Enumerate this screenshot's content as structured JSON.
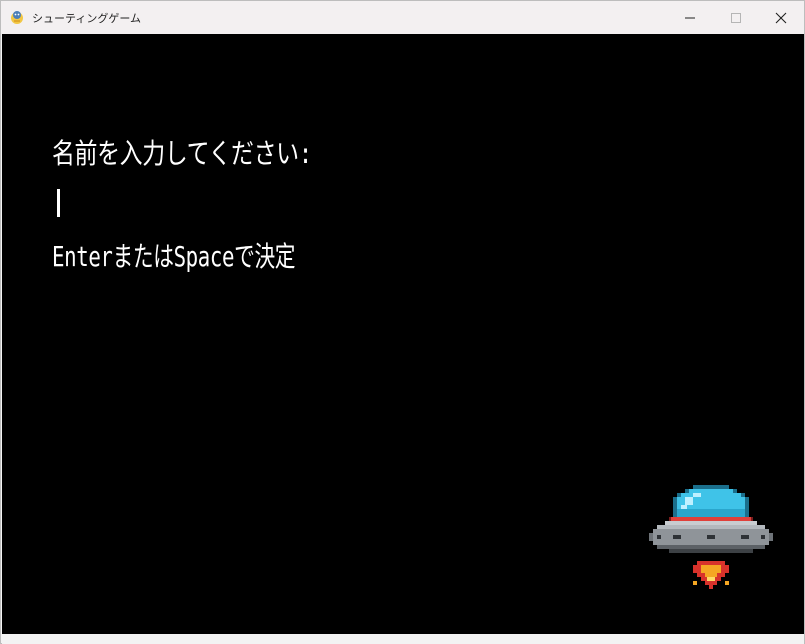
{
  "window": {
    "title": "シューティングゲーム",
    "app_icon": "pygame-snake-icon",
    "controls": {
      "minimize_icon": "minimize-icon",
      "maximize_icon": "maximize-icon",
      "close_icon": "close-icon"
    }
  },
  "game": {
    "background_color": "#000000",
    "prompt": "名前を入力してください:",
    "name_input_value": "",
    "hint": "EnterまたはSpaceで決定",
    "sprite": "ufo-spaceship-icon",
    "colors": {
      "text": "#ffffff",
      "dome": "#3fc3e8",
      "stripe": "#e0403a",
      "hull": "#8f9499",
      "flame": "#f5a623"
    }
  }
}
